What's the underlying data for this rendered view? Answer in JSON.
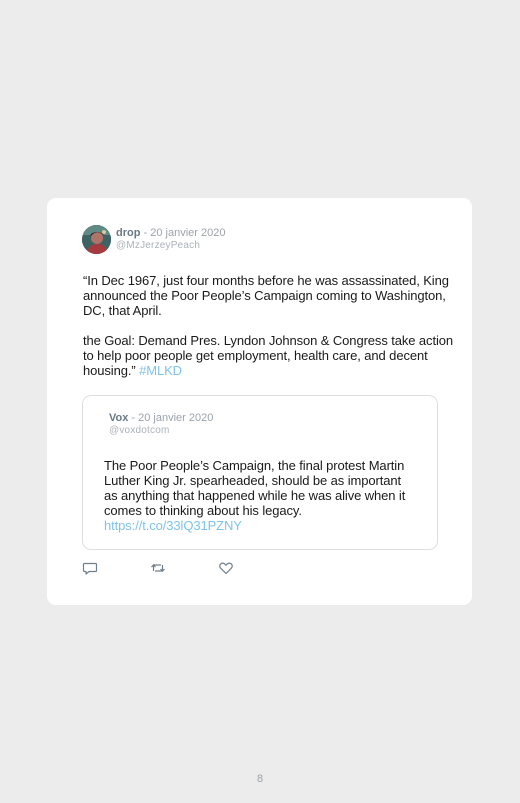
{
  "tweet": {
    "author_name": "drop",
    "separator": " - ",
    "date": "20 janvier 2020",
    "handle": "@MzJerzeyPeach",
    "paragraph1": "“In Dec 1967, just four months before he was assassinated, King announced the Poor People’s Campaign coming to Washington, DC, that April.",
    "paragraph2": "the Goal: Demand Pres. Lyndon Johnson & Congress take action to help poor people get employment, health care, and decent housing.” ",
    "hashtag": "#MLKD"
  },
  "quoted_tweet": {
    "author_name": "Vox",
    "separator": " - ",
    "date": "20 janvier 2020",
    "handle": "@voxdotcom",
    "text": "The Poor People’s Campaign, the final protest Martin Luther King Jr. spearheaded, should be as important as anything that happened while he was alive when it comes to thinking about his legacy. ",
    "link": "https://t.co/33lQ31PZNY"
  },
  "actions": {
    "reply_icon": "reply-icon",
    "retweet_icon": "retweet-icon",
    "like_icon": "heart-icon"
  },
  "page": {
    "number": "8"
  },
  "colors": {
    "background": "#ececec",
    "card": "#ffffff",
    "link": "#7ec4e8",
    "meta": "#9aa3ab"
  }
}
